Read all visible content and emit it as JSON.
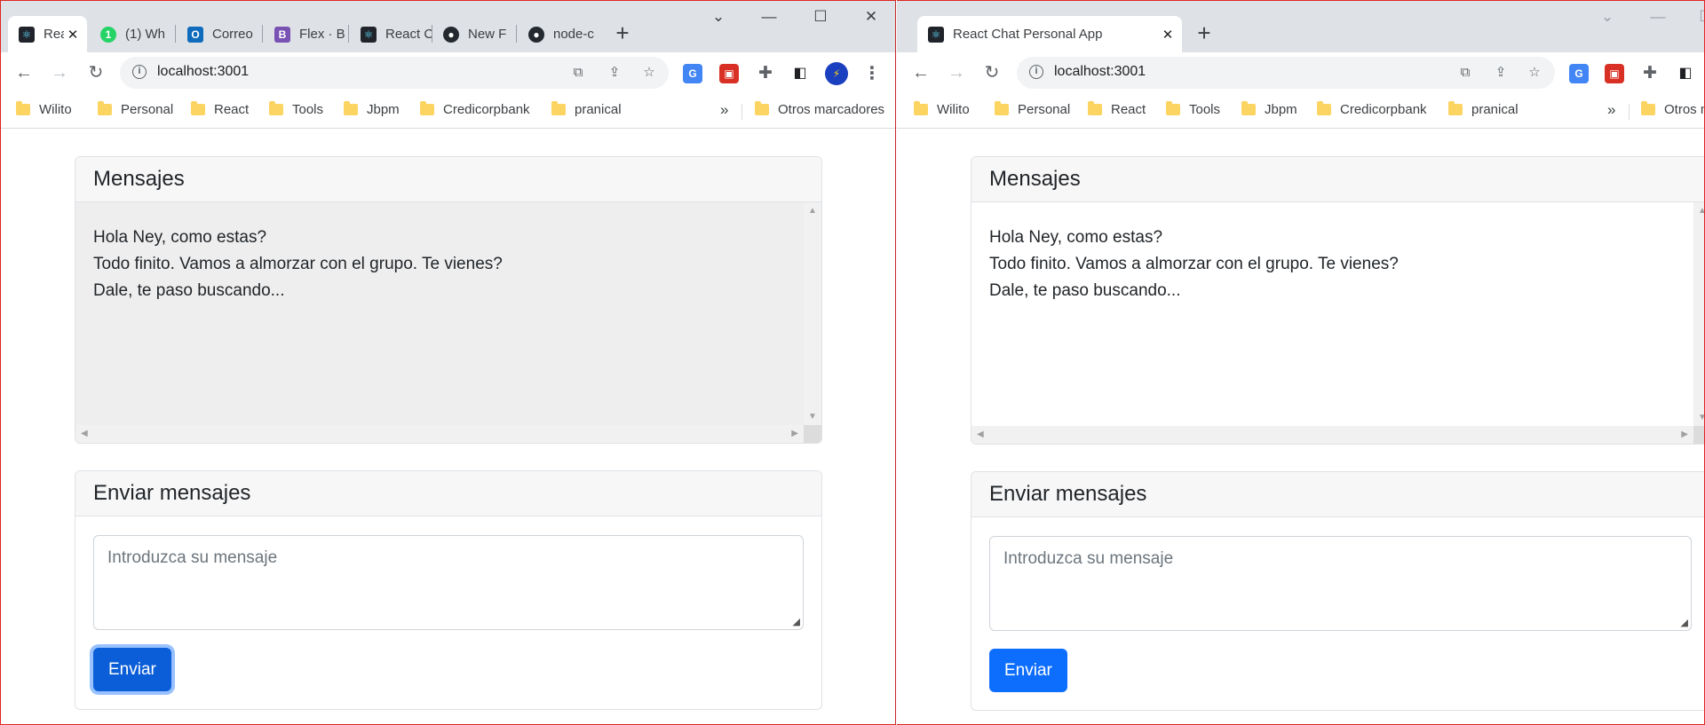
{
  "left_window": {
    "tabs": [
      {
        "label": "Rea",
        "icon": "react-icon",
        "active": true
      },
      {
        "label": "(1) Wh",
        "icon": "whatsapp-icon"
      },
      {
        "label": "Correo",
        "icon": "outlook-icon"
      },
      {
        "label": "Flex · B",
        "icon": "bootstrap-icon"
      },
      {
        "label": "React C",
        "icon": "react-icon"
      },
      {
        "label": "New F",
        "icon": "github-icon"
      },
      {
        "label": "node-c",
        "icon": "github-icon"
      }
    ],
    "address": "localhost:3001",
    "bookmarks": [
      "Wilito",
      "Personal",
      "React",
      "Tools",
      "Jbpm",
      "Credicorpbank",
      "pranical"
    ],
    "bookmarks_more": "»",
    "other_bookmarks": "Otros marcadores",
    "messages_title": "Mensajes",
    "messages": [
      "Hola Ney, como estas?",
      "Todo finito. Vamos a almorzar con el grupo. Te vienes?",
      "Dale, te paso buscando..."
    ],
    "send_title": "Enviar mensajes",
    "input_placeholder": "Introduzca su mensaje",
    "send_button": "Enviar"
  },
  "right_window": {
    "tabs": [
      {
        "label": "React Chat Personal App",
        "icon": "react-icon",
        "active": true
      }
    ],
    "address": "localhost:3001",
    "bookmarks": [
      "Wilito",
      "Personal",
      "React",
      "Tools",
      "Jbpm",
      "Credicorpbank",
      "pranical"
    ],
    "bookmarks_more": "»",
    "other_bookmarks": "Otros m",
    "messages_title": "Mensajes",
    "messages": [
      "Hola Ney, como estas?",
      "Todo finito. Vamos a almorzar con el grupo. Te vienes?",
      "Dale, te paso buscando..."
    ],
    "send_title": "Enviar mensajes",
    "input_placeholder": "Introduzca su mensaje",
    "send_button": "Enviar"
  },
  "colors": {
    "primary": "#0d6efd",
    "window_border": "#e02424",
    "tabstrip": "#dee1e6",
    "message_bg": "#eeeeee"
  }
}
